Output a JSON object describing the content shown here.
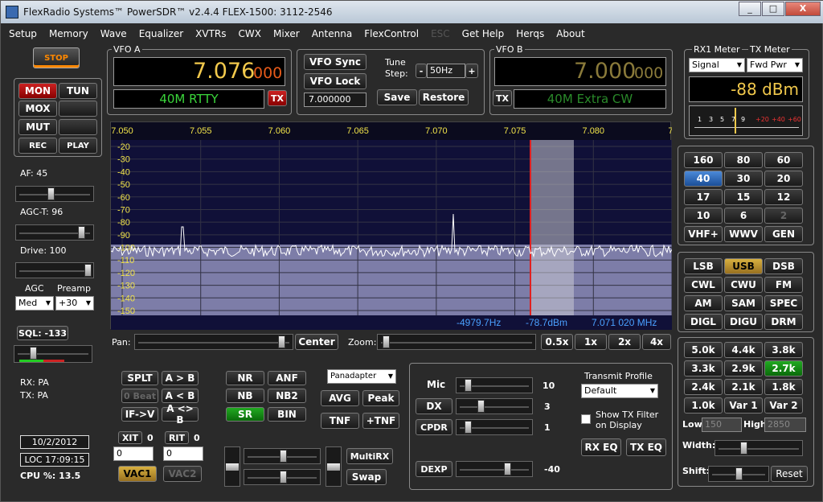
{
  "window": {
    "title": "FlexRadio Systems™  PowerSDR™  v2.4.4   FLEX-1500: 3112-2546",
    "min": "_",
    "max": "□",
    "close": "X"
  },
  "menu": [
    "Setup",
    "Memory",
    "Wave",
    "Equalizer",
    "XVTRs",
    "CWX",
    "Mixer",
    "Antenna",
    "FlexControl",
    "ESC",
    "Get Help",
    "Herqs",
    "About"
  ],
  "stop": "STOP",
  "left_buttons": {
    "mon": "MON",
    "tun": "TUN",
    "mox": "MOX",
    "mut": "MUT",
    "rec": "REC",
    "play": "PLAY"
  },
  "af": {
    "label": "AF:",
    "value": "45",
    "level": 0.45
  },
  "agct": {
    "label": "AGC-T:",
    "value": "96",
    "level": 0.9
  },
  "drive": {
    "label": "Drive:",
    "value": "100",
    "level": 1.0
  },
  "agc": {
    "label": "AGC",
    "value": "Med"
  },
  "preamp": {
    "label": "Preamp",
    "value": "+30"
  },
  "sql": {
    "label": "SQL:",
    "value": "-133",
    "level": 0.2
  },
  "rx_ant": "RX: PA",
  "tx_ant": "TX: PA",
  "date": "10/2/2012",
  "loc": "LOC 17:09:15",
  "cpu": "CPU %: 13.5",
  "vfo_a": {
    "label": "VFO A",
    "freq_main": "7.076",
    "freq_sub": "000",
    "mode": "40M RTTY",
    "tx": "TX"
  },
  "vfo_b": {
    "label": "VFO B",
    "freq_main": "7.000",
    "freq_sub": "000",
    "mode": "40M Extra CW",
    "tx": "TX"
  },
  "vfo_sync": "VFO Sync",
  "vfo_lock": "VFO Lock",
  "vfo_box_val": "7.000000",
  "tune_step": {
    "label1": "Tune",
    "label2": "Step:",
    "minus": "-",
    "value": "50Hz",
    "plus": "+"
  },
  "save": "Save",
  "restore": "Restore",
  "meters": {
    "rx1_label": "RX1 Meter",
    "tx_label": "TX Meter",
    "rx_sel": "Signal",
    "tx_sel": "Fwd Pwr",
    "readout": "-88 dBm",
    "scale": [
      "1",
      "3",
      "5",
      "7",
      "9",
      "+20",
      "+40",
      "+60"
    ]
  },
  "spectrum": {
    "x_ticks": [
      "7.050",
      "7.055",
      "7.060",
      "7.065",
      "7.070",
      "7.075",
      "7.080",
      "7."
    ],
    "y_ticks": [
      "-20",
      "-30",
      "-40",
      "-50",
      "-60",
      "-70",
      "-80",
      "-90",
      "-100",
      "-110",
      "-120",
      "-130",
      "-140",
      "-150"
    ],
    "readout_hz": "-4979.7Hz",
    "readout_dbm": "-78.7dBm",
    "readout_mhz": "7.071 020 MHz"
  },
  "pan": {
    "label": "Pan:",
    "center": "Center",
    "level": 0.96
  },
  "zoom": {
    "label": "Zoom:",
    "level": 0.02,
    "opts": [
      "0.5x",
      "1x",
      "2x",
      "4x"
    ]
  },
  "band_buttons": [
    "160",
    "80",
    "60",
    "40",
    "30",
    "20",
    "17",
    "15",
    "12",
    "10",
    "6",
    "2",
    "VHF+",
    "WWV",
    "GEN"
  ],
  "mode_buttons": [
    "LSB",
    "USB",
    "DSB",
    "CWL",
    "CWU",
    "FM",
    "AM",
    "SAM",
    "SPEC",
    "DIGL",
    "DIGU",
    "DRM"
  ],
  "filter_buttons": [
    "5.0k",
    "4.4k",
    "3.8k",
    "3.3k",
    "2.9k",
    "2.7k",
    "2.4k",
    "2.1k",
    "1.8k",
    "1.0k",
    "Var 1",
    "Var 2"
  ],
  "filter_low": {
    "label": "Low",
    "value": "150"
  },
  "filter_high": {
    "label": "High",
    "value": "2850"
  },
  "width": {
    "label": "Width:",
    "level": 0.3
  },
  "shift": {
    "label": "Shift:",
    "level": 0.5,
    "reset": "Reset"
  },
  "vfo_ops": {
    "splt": "SPLT",
    "a_to_b": "A > B",
    "zero_beat": "0 Beat",
    "b_to_a": "A < B",
    "if_v": "IF->V",
    "swap": "A <> B"
  },
  "xit": {
    "label": "XIT",
    "value": "0",
    "box": "0"
  },
  "rit": {
    "label": "RIT",
    "value": "0",
    "box": "0"
  },
  "vac1": "VAC1",
  "vac2": "VAC2",
  "dsp": {
    "nr": "NR",
    "anf": "ANF",
    "nb": "NB",
    "nb2": "NB2",
    "sr": "SR",
    "bin": "BIN"
  },
  "display_mode": "Panadapter",
  "avg": "AVG",
  "peak": "Peak",
  "tnf": "TNF",
  "ptnf": "+TNF",
  "multirx": "MultiRX",
  "swapbtn": "Swap",
  "tx": {
    "mic": "Mic",
    "mic_val": "10",
    "mic_level": 0.1,
    "dx": "DX",
    "dx_val": "3",
    "dx_level": 0.3,
    "cpdr": "CPDR",
    "cpdr_val": "1",
    "cpdr_level": 0.1,
    "dexp": "DEXP",
    "dexp_val": "-40",
    "dexp_level": 0.7
  },
  "tx_profile": {
    "label": "Transmit Profile",
    "value": "Default",
    "show_filter": "Show TX Filter on Display",
    "rx_eq": "RX EQ",
    "tx_eq": "TX EQ"
  }
}
